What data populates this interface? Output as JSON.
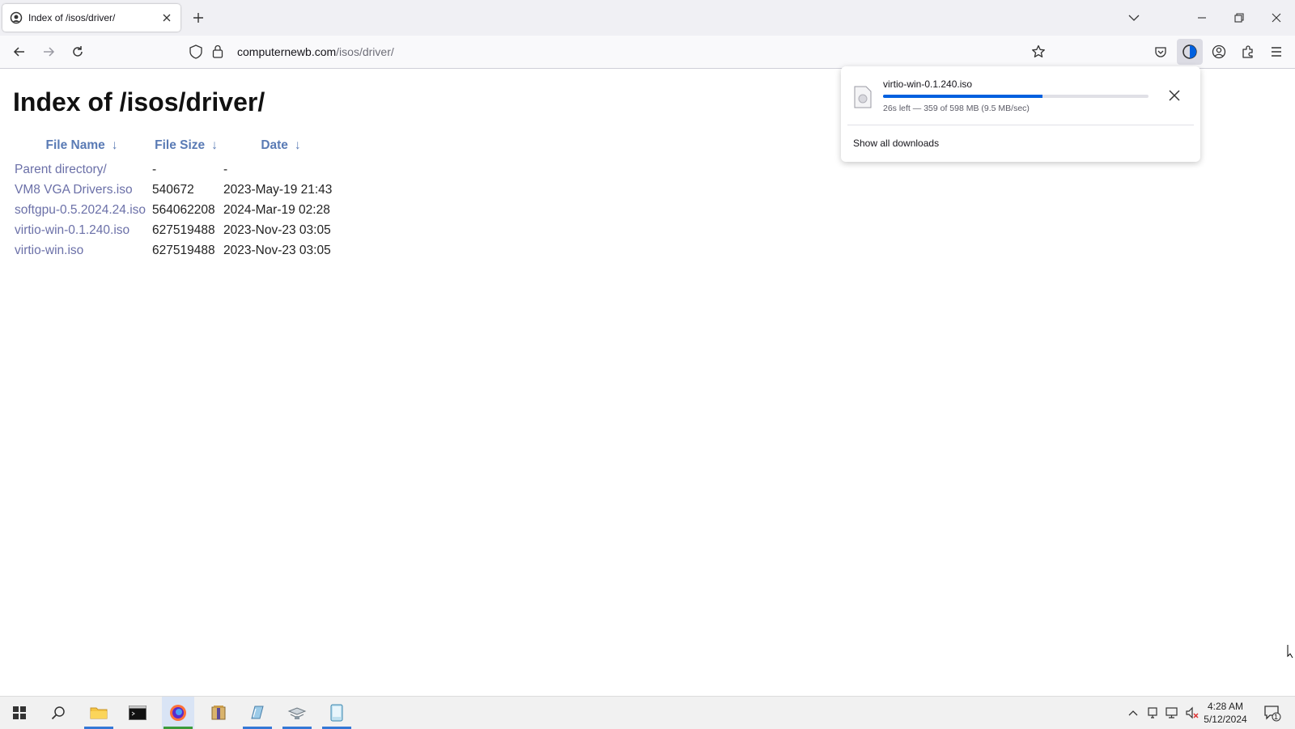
{
  "browser": {
    "tab_title": "Index of /isos/driver/",
    "url_domain": "computernewb.com",
    "url_path": "/isos/driver/"
  },
  "page": {
    "title": "Index of /isos/driver/",
    "columns": {
      "name": "File Name",
      "size": "File Size",
      "date": "Date",
      "sort_arrow": "↓"
    },
    "rows": [
      {
        "name": "Parent directory/",
        "size": "-",
        "date": "-"
      },
      {
        "name": "VM8 VGA Drivers.iso",
        "size": "540672",
        "date": "2023-May-19 21:43"
      },
      {
        "name": "softgpu-0.5.2024.24.iso",
        "size": "564062208",
        "date": "2024-Mar-19 02:28"
      },
      {
        "name": "virtio-win-0.1.240.iso",
        "size": "627519488",
        "date": "2023-Nov-23 03:05"
      },
      {
        "name": "virtio-win.iso",
        "size": "627519488",
        "date": "2023-Nov-23 03:05"
      }
    ]
  },
  "downloads": {
    "file_name": "virtio-win-0.1.240.iso",
    "progress": 0.6,
    "status": "26s left — 359 of 598 MB (9.5 MB/sec)",
    "show_all": "Show all downloads"
  },
  "taskbar": {
    "time": "4:28 AM",
    "date": "5/12/2024",
    "notification_count": "1"
  },
  "colors": {
    "link": "#6b70a8",
    "header": "#5a7bb5",
    "progress": "#0060df",
    "taskbar_active": "#3478d6"
  }
}
